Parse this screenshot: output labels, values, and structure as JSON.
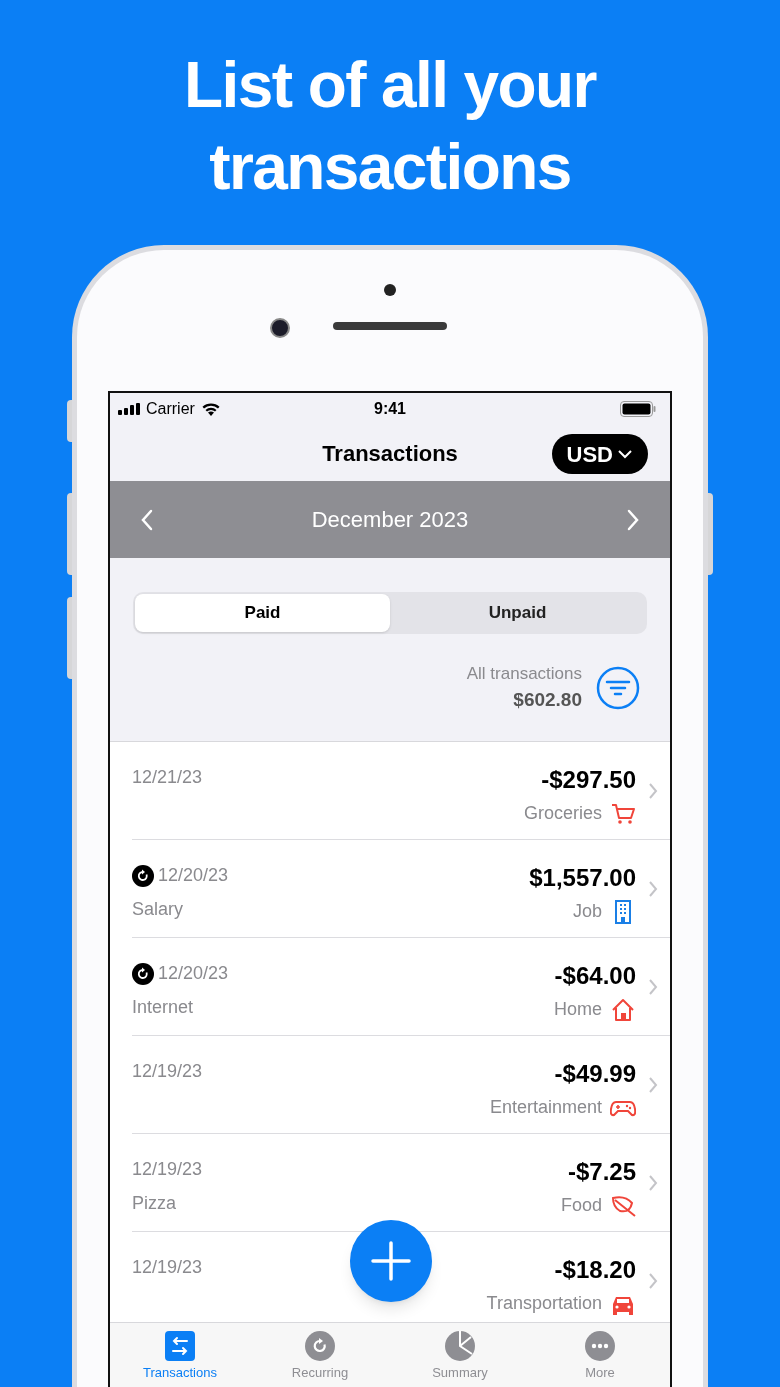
{
  "headline": "List of all your transactions",
  "status_bar": {
    "carrier": "Carrier",
    "time": "9:41"
  },
  "nav": {
    "title": "Transactions",
    "currency": "USD"
  },
  "month_bar": {
    "label": "December 2023"
  },
  "segments": [
    {
      "label": "Paid",
      "selected": true
    },
    {
      "label": "Unpaid",
      "selected": false
    }
  ],
  "summary": {
    "label": "All transactions",
    "total": "$602.80"
  },
  "transactions": [
    {
      "date": "12/21/23",
      "recurring": false,
      "amount": "-$297.50",
      "category": "Groceries",
      "kind": "cart",
      "color": "#f0453a"
    },
    {
      "date": "12/20/23",
      "recurring": true,
      "note": "Salary",
      "amount": "$1,557.00",
      "category": "Job",
      "kind": "building",
      "color": "#1a7fe6"
    },
    {
      "date": "12/20/23",
      "recurring": true,
      "note": "Internet",
      "amount": "-$64.00",
      "category": "Home",
      "kind": "house",
      "color": "#f0453a"
    },
    {
      "date": "12/19/23",
      "recurring": false,
      "amount": "-$49.99",
      "category": "Entertainment",
      "kind": "gamepad",
      "color": "#f0453a"
    },
    {
      "date": "12/19/23",
      "recurring": false,
      "note": "Pizza",
      "amount": "-$7.25",
      "category": "Food",
      "kind": "leaf",
      "color": "#f0453a"
    },
    {
      "date": "12/19/23",
      "recurring": false,
      "amount": "-$18.20",
      "category": "Transportation",
      "kind": "car",
      "color": "#f0453a"
    }
  ],
  "tabs": [
    {
      "label": "Transactions",
      "kind": "arrows",
      "selected": true
    },
    {
      "label": "Recurring",
      "kind": "repeat",
      "selected": false
    },
    {
      "label": "Summary",
      "kind": "pie",
      "selected": false
    },
    {
      "label": "More",
      "kind": "dots",
      "selected": false
    }
  ]
}
